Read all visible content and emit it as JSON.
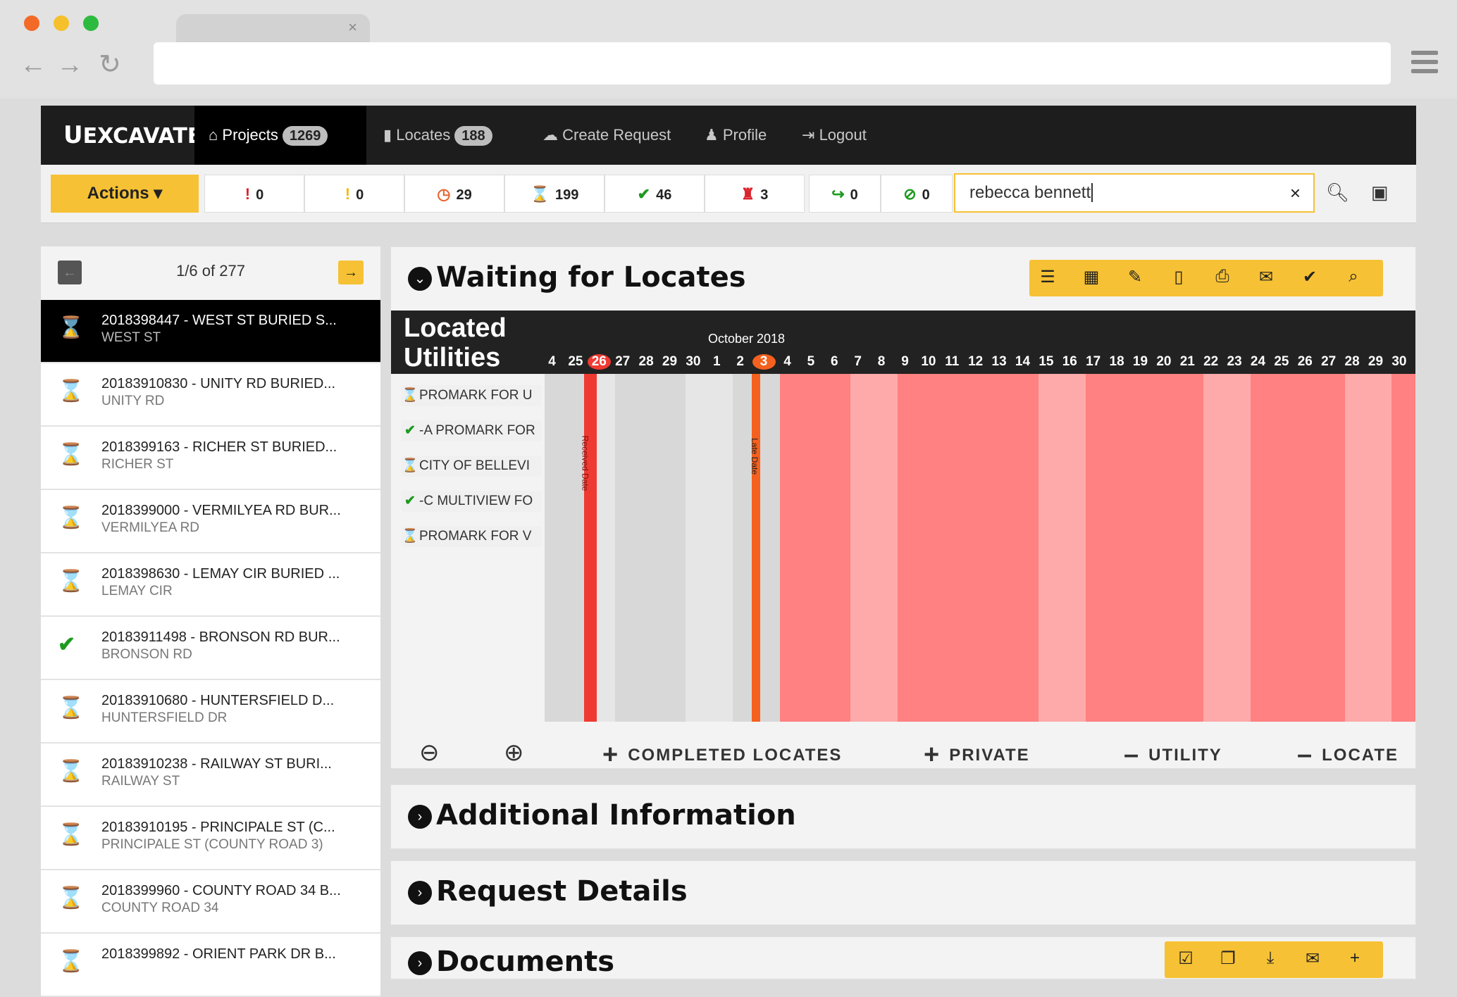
{
  "browser": {
    "tab_close": "×",
    "back": "←",
    "forward": "→",
    "reload": "↻"
  },
  "nav": {
    "logo": "EXCAVATE",
    "items": [
      {
        "label": "Projects",
        "badge": "1269",
        "icon": "home-icon"
      },
      {
        "label": "Locates",
        "badge": "188",
        "icon": "file-icon"
      },
      {
        "label": "Create Request",
        "icon": "cloud-upload-icon"
      },
      {
        "label": "Profile",
        "icon": "user-icon"
      },
      {
        "label": "Logout",
        "icon": "logout-icon"
      }
    ]
  },
  "toolbar": {
    "actions_label": "Actions ▾",
    "stats": [
      {
        "icon": "!",
        "value": "0",
        "color": "#d9232d",
        "name": "urgent-icon"
      },
      {
        "icon": "!",
        "value": "0",
        "color": "#f2b90f",
        "name": "warning-icon"
      },
      {
        "icon": "◷",
        "value": "29",
        "color": "#e8622c",
        "name": "clock-icon"
      },
      {
        "icon": "⌛",
        "value": "199",
        "color": "#888888",
        "name": "hourglass-icon"
      },
      {
        "icon": "✔",
        "value": "46",
        "color": "#1e9a1e",
        "name": "check-icon"
      },
      {
        "icon": "♜",
        "value": "3",
        "color": "#d9232d",
        "name": "person-icon"
      },
      {
        "icon": "↪",
        "value": "0",
        "color": "#1e9a1e",
        "name": "share-icon"
      },
      {
        "icon": "⊘",
        "value": "0",
        "color": "#1e9a1e",
        "name": "check-circle-icon"
      }
    ],
    "search_value": "rebecca bennett",
    "clear": "×"
  },
  "list": {
    "pager_label": "1/6 of 277",
    "items": [
      {
        "title": "2018398447 - WEST ST BURIED S...",
        "sub": "WEST ST",
        "status": "waiting",
        "selected": true
      },
      {
        "title": "20183910830 - UNITY RD BURIED...",
        "sub": "UNITY RD",
        "status": "waiting"
      },
      {
        "title": "2018399163 - RICHER ST BURIED...",
        "sub": "RICHER ST",
        "status": "waiting"
      },
      {
        "title": "2018399000 - VERMILYEA RD BUR...",
        "sub": "VERMILYEA RD",
        "status": "waiting"
      },
      {
        "title": "2018398630 - LEMAY CIR BURIED ...",
        "sub": "LEMAY CIR",
        "status": "waiting"
      },
      {
        "title": "20183911498 - BRONSON RD BUR...",
        "sub": "BRONSON RD",
        "status": "done"
      },
      {
        "title": "20183910680 - HUNTERSFIELD D...",
        "sub": "HUNTERSFIELD DR",
        "status": "waiting"
      },
      {
        "title": "20183910238 - RAILWAY ST BURI...",
        "sub": "RAILWAY ST",
        "status": "waiting"
      },
      {
        "title": "20183910195 - PRINCIPALE ST (C...",
        "sub": "PRINCIPALE ST (COUNTY ROAD 3)",
        "status": "waiting"
      },
      {
        "title": "2018399960 - COUNTY ROAD 34 B...",
        "sub": "COUNTY ROAD 34",
        "status": "waiting"
      },
      {
        "title": "2018399892 - ORIENT PARK DR B...",
        "sub": "",
        "status": "waiting"
      }
    ]
  },
  "waiting": {
    "title": "Waiting for Locates",
    "located_title": "Located Utilities",
    "month": "October 2018",
    "days": [
      "4",
      "25",
      "26",
      "27",
      "28",
      "29",
      "30",
      "1",
      "2",
      "3",
      "4",
      "5",
      "6",
      "7",
      "8",
      "9",
      "10",
      "11",
      "12",
      "13",
      "14",
      "15",
      "16",
      "17",
      "18",
      "19",
      "20",
      "21",
      "22",
      "23",
      "24",
      "25",
      "26",
      "27",
      "28",
      "29",
      "30"
    ],
    "utilities": [
      {
        "label": "PROMARK FOR U",
        "status": "waiting"
      },
      {
        "label": "-A PROMARK FOR",
        "status": "done"
      },
      {
        "label": "CITY OF BELLEVI",
        "status": "waiting"
      },
      {
        "label": "-C MULTIVIEW FO",
        "status": "done"
      },
      {
        "label": "PROMARK FOR V",
        "status": "waiting"
      }
    ],
    "markers": {
      "received": "Received Date",
      "late": "Late Date"
    },
    "legend": [
      {
        "sym": "+",
        "label": "COMPLETED LOCATES"
      },
      {
        "sym": "+",
        "label": "PRIVATE"
      },
      {
        "sym": "–",
        "label": "UTILITY"
      },
      {
        "sym": "–",
        "label": "LOCATE"
      }
    ]
  },
  "panels": {
    "additional": "Additional Information",
    "request": "Request Details",
    "documents": "Documents"
  },
  "colors": {
    "accent": "#f6c134",
    "late": "#ff8181",
    "late_light": "#ffaaaa",
    "received": "#ef3a32",
    "late_marker": "#f4601e"
  }
}
